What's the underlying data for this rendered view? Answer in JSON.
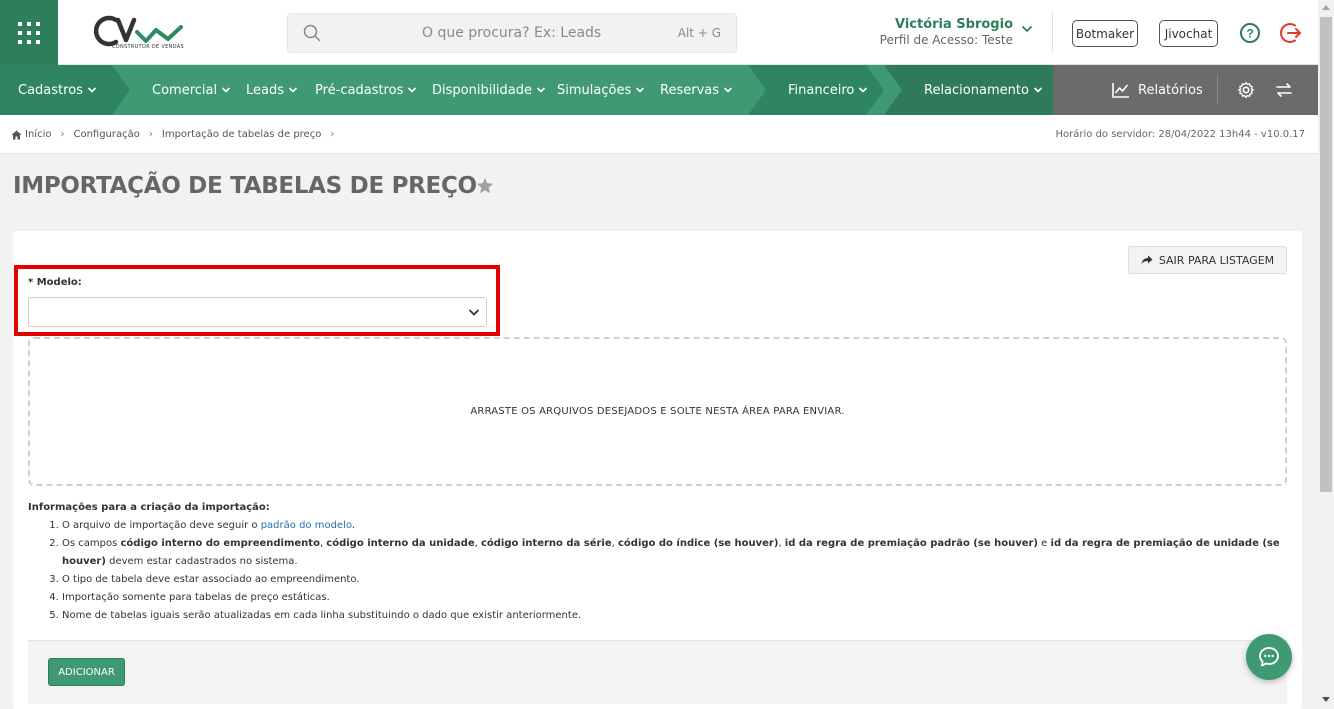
{
  "header": {
    "brand_sub": "CONSTRUTOR DE VENDAS",
    "search_placeholder": "O que procura? Ex: Leads",
    "search_shortcut": "Alt + G",
    "user_name": "Victória Sbrogio",
    "user_profile": "Perfil de Acesso: Teste",
    "botmaker_label": "Botmaker",
    "jivochat_label": "Jivochat",
    "help_label": "?"
  },
  "nav": {
    "items": [
      {
        "label": "Cadastros"
      },
      {
        "label": "Comercial"
      },
      {
        "label": "Leads"
      },
      {
        "label": "Pré-cadastros"
      },
      {
        "label": "Disponibilidade"
      },
      {
        "label": "Simulações"
      },
      {
        "label": "Reservas"
      },
      {
        "label": "Financeiro"
      },
      {
        "label": "Relacionamento"
      }
    ],
    "reports_label": "Relatórios"
  },
  "breadcrumb": {
    "items": [
      "Início",
      "Configuração",
      "Importação de tabelas de preço"
    ],
    "server_time": "Horário do servidor: 28/04/2022 13h44 - v10.0.17"
  },
  "page": {
    "title": "IMPORTAÇÃO DE TABELAS DE PREÇO",
    "exit_button": "SAIR PARA LISTAGEM",
    "modelo_label": "* Modelo:",
    "modelo_value": "",
    "dropzone_text": "ARRASTE OS ARQUIVOS DESEJADOS E SOLTE NESTA ÁREA PARA ENVIAR.",
    "info_title": "Informações para a criação da importação:",
    "info": {
      "item1_pre": "O arquivo de importação deve seguir o ",
      "item1_link": "padrão do modelo",
      "item1_post": ".",
      "item2_pre": "Os campos ",
      "item2_b1": "código interno do empreendimento",
      "item2_c1": ", ",
      "item2_b2": "código interno da unidade",
      "item2_c2": ", ",
      "item2_b3": "código interno da série",
      "item2_c3": ", ",
      "item2_b4": "código do índice (se houver)",
      "item2_c4": ", ",
      "item2_b5": "id da regra de premiação padrão (se houver)",
      "item2_c5": " e ",
      "item2_b6": "id da regra de premiação de unidade (se houver)",
      "item2_post": " devem estar cadastrados no sistema.",
      "item3": "O tipo de tabela deve estar associado ao empreendimento.",
      "item4": "Importação somente para tabelas de preço estáticas.",
      "item5": "Nome de tabelas iguais serão atualizadas em cada linha substituindo o dado que existir anteriormente."
    },
    "add_button": "ADICIONAR"
  },
  "colors": {
    "brand_green": "#3f9a73",
    "dark_green": "#2e7d5b",
    "highlight_red": "#e00000",
    "exit_red": "#e03c2c"
  }
}
